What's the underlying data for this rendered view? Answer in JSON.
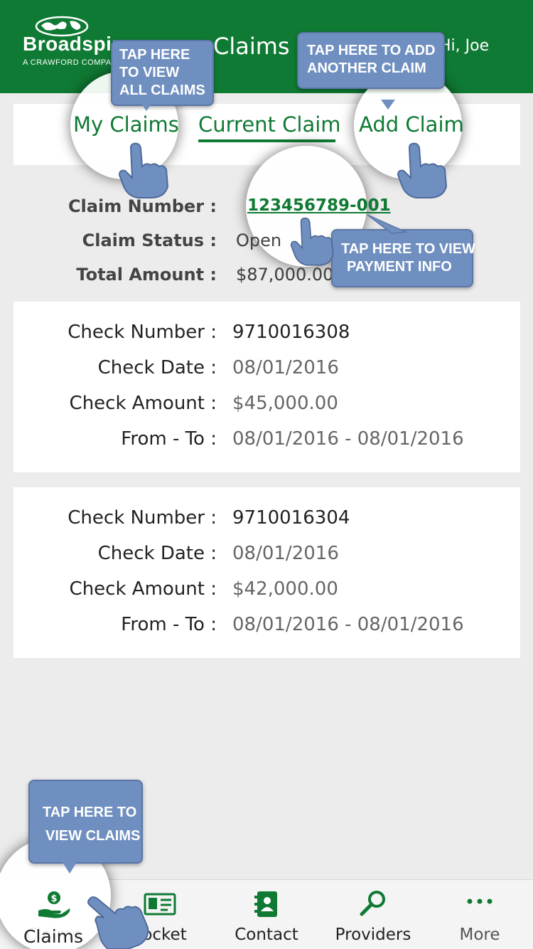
{
  "header": {
    "brand": "Broadspire",
    "brand_tagline": "A CRAWFORD COMPANY",
    "title": "Claims",
    "greeting": "Hi, Joe"
  },
  "tabs": {
    "my_claims": "My Claims",
    "current_claim": "Current Claim",
    "add_claim": "Add Claim",
    "active": "current_claim"
  },
  "summary": {
    "claim_number_label": "Claim Number :",
    "claim_number": "123456789-001",
    "status_label": "Claim Status :",
    "status": "Open",
    "total_label": "Total Amount :",
    "total": "$87,000.00"
  },
  "checks": [
    {
      "number_label": "Check Number :",
      "number": "9710016308",
      "date_label": "Check Date :",
      "date": "08/01/2016",
      "amount_label": "Check Amount :",
      "amount": "$45,000.00",
      "range_label": "From - To :",
      "range": "08/01/2016 - 08/01/2016"
    },
    {
      "number_label": "Check Number :",
      "number": "9710016304",
      "date_label": "Check Date :",
      "date": "08/01/2016",
      "amount_label": "Check Amount :",
      "amount": "$42,000.00",
      "range_label": "From - To :",
      "range": "08/01/2016 - 08/01/2016"
    }
  ],
  "bottom_nav": [
    {
      "label": "Claims",
      "icon": "hand-money-icon",
      "active": true
    },
    {
      "label": "Pocket",
      "icon": "id-card-icon"
    },
    {
      "label": "Contact",
      "icon": "address-book-icon"
    },
    {
      "label": "Providers",
      "icon": "magnifier-icon"
    },
    {
      "label": "More",
      "icon": "more-dots-icon"
    }
  ],
  "tutorial": {
    "my_claims_tip": [
      "TAP HERE",
      "TO VIEW",
      "ALL CLAIMS"
    ],
    "add_claim_tip": [
      "TAP HERE TO ADD",
      "ANOTHER CLAIM"
    ],
    "payment_tip": [
      "TAP HERE TO VIEW",
      "PAYMENT INFO"
    ],
    "claims_tip": [
      "TAP HERE TO",
      "VIEW CLAIMS"
    ]
  },
  "colors": {
    "brand_green": "#0f7a33",
    "tip_blue": "#6f8fc0",
    "background": "#ececec"
  }
}
